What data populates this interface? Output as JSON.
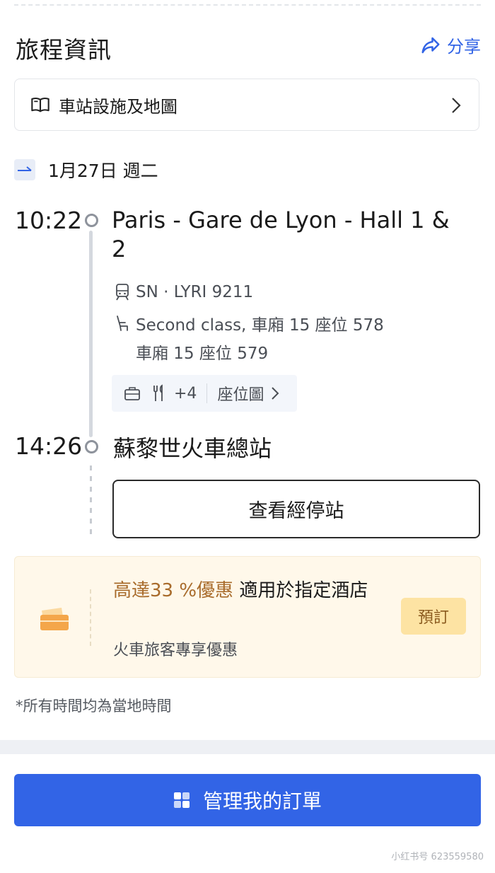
{
  "header": {
    "title": "旅程資訊",
    "share_label": "分享"
  },
  "facility": {
    "label": "車站設施及地圖"
  },
  "journey": {
    "date": "1月27日 週二",
    "departure": {
      "time": "10:22",
      "station": "Paris - Gare de Lyon - Hall 1 & 2"
    },
    "train": {
      "info": "SN · LYRI 9211"
    },
    "seats": {
      "line1": "Second class, 車廂 15  座位 578",
      "line2": "車廂 15  座位 579"
    },
    "amenities": {
      "more": "+4",
      "seat_map_label": "座位圖"
    },
    "arrival": {
      "time": "14:26",
      "station": "蘇黎世火車總站"
    },
    "stops_button": "查看經停站"
  },
  "promo": {
    "highlight": "高達33 %優惠",
    "text": " 適用於指定酒店",
    "subtext": "火車旅客專享優惠",
    "button": "預訂"
  },
  "footnote": "*所有時間均為當地時間",
  "manage_button": "管理我的訂單",
  "watermark": "小红书号 623559580",
  "colors": {
    "primary": "#3264e6",
    "promo_bg": "#fff8ea",
    "promo_accent": "#a86b2b",
    "promo_button": "#fde3a3"
  },
  "icons": [
    "share-icon",
    "book-icon",
    "chevron-right-icon",
    "direction-arrow-icon",
    "train-icon",
    "seat-icon",
    "luggage-icon",
    "dining-icon",
    "ticket-icon",
    "grid-icon"
  ]
}
